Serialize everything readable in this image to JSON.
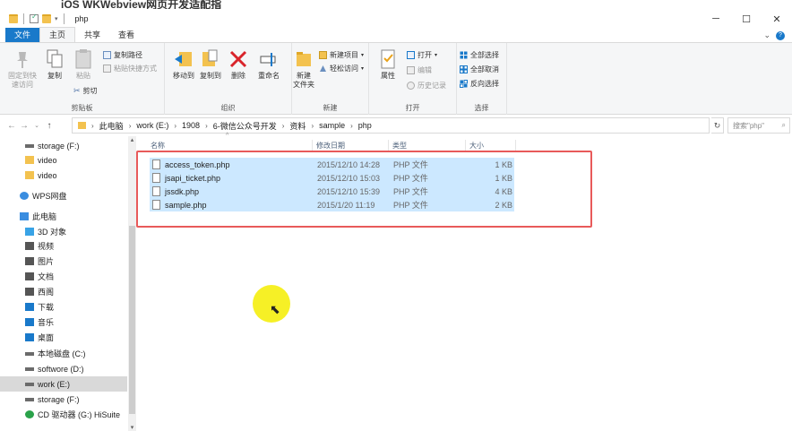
{
  "overlay_title": "iOS WKWebview网页开发适配指",
  "window": {
    "title": "php",
    "minimize": "─",
    "maximize": "☐",
    "close": "✕"
  },
  "tabs": {
    "file": "文件",
    "home": "主页",
    "share": "共享",
    "view": "查看"
  },
  "ribbon": {
    "clipboard": {
      "label": "剪贴板",
      "pin": "固定到快\n速访问",
      "copy": "复制",
      "paste": "粘贴",
      "copy_path": "复制路径",
      "paste_shortcut": "粘贴快捷方式",
      "cut": "剪切"
    },
    "organize": {
      "label": "组织",
      "move_to": "移动到",
      "copy_to": "复制到",
      "delete": "删除",
      "rename": "重命名"
    },
    "new": {
      "label": "新建",
      "new_folder": "新建\n文件夹",
      "new_item": "新建项目",
      "easy_access": "轻松访问"
    },
    "open": {
      "label": "打开",
      "properties": "属性",
      "open": "打开",
      "edit": "编辑",
      "history": "历史记录"
    },
    "select": {
      "label": "选择",
      "select_all": "全部选择",
      "select_none": "全部取消",
      "invert": "反向选择"
    }
  },
  "address": {
    "crumbs": [
      "此电脑",
      "work (E:)",
      "1908",
      "6-微信公众号开发",
      "资料",
      "sample",
      "php"
    ],
    "search_placeholder": "搜索\"php\""
  },
  "nav": [
    {
      "label": "storage (F:)",
      "icon": "drive-icon"
    },
    {
      "label": "video",
      "icon": "folder-icon"
    },
    {
      "label": "video",
      "icon": "folder-icon"
    },
    {
      "label": "WPS网盘",
      "icon": "cloud-icon"
    },
    {
      "label": "此电脑",
      "icon": "computer-icon"
    },
    {
      "label": "3D 对象",
      "icon": "3d-icon"
    },
    {
      "label": "视频",
      "icon": "video-icon"
    },
    {
      "label": "图片",
      "icon": "picture-icon"
    },
    {
      "label": "文档",
      "icon": "document-icon"
    },
    {
      "label": "西阁",
      "icon": "phone-icon"
    },
    {
      "label": "下载",
      "icon": "download-icon"
    },
    {
      "label": "音乐",
      "icon": "music-icon"
    },
    {
      "label": "桌面",
      "icon": "desktop-icon"
    },
    {
      "label": "本地磁盘 (C:)",
      "icon": "drive-icon"
    },
    {
      "label": "softwore (D:)",
      "icon": "drive-icon"
    },
    {
      "label": "work (E:)",
      "icon": "drive-icon"
    },
    {
      "label": "storage (F:)",
      "icon": "drive-icon"
    },
    {
      "label": "CD 驱动器 (G:) HiSuite",
      "icon": "cd-icon"
    }
  ],
  "columns": {
    "name": "名称",
    "date": "修改日期",
    "type": "类型",
    "size": "大小"
  },
  "files": [
    {
      "name": "access_token.php",
      "date": "2015/12/10 14:28",
      "type": "PHP 文件",
      "size": "1 KB"
    },
    {
      "name": "jsapi_ticket.php",
      "date": "2015/12/10 15:03",
      "type": "PHP 文件",
      "size": "1 KB"
    },
    {
      "name": "jssdk.php",
      "date": "2015/12/10 15:39",
      "type": "PHP 文件",
      "size": "4 KB"
    },
    {
      "name": "sample.php",
      "date": "2015/1/20 11:19",
      "type": "PHP 文件",
      "size": "2 KB"
    }
  ],
  "colors": {
    "accent": "#1979ca",
    "selection": "#cce8ff",
    "highlight_box": "#e85a5a",
    "cursor_halo": "#f5ef14"
  }
}
